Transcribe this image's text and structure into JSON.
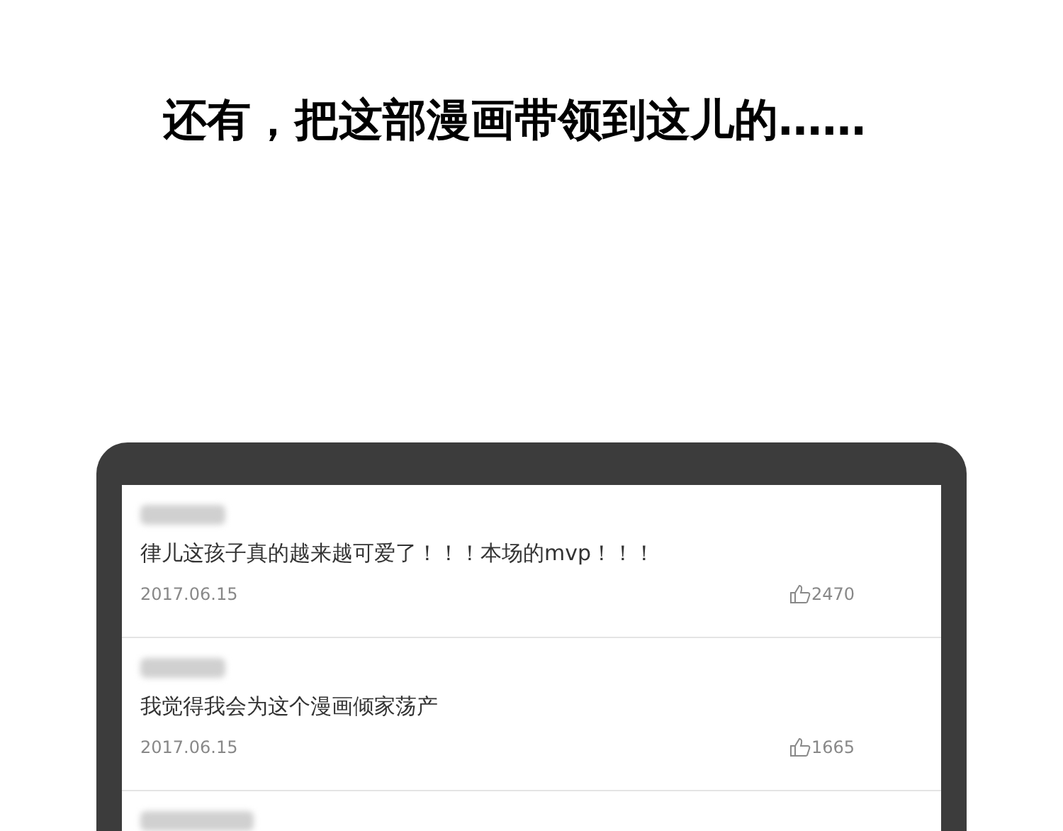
{
  "caption": "还有，把这部漫画带领到这儿的……",
  "comments": [
    {
      "text": "律儿这孩子真的越来越可爱了！！！本场的mvp！！！",
      "date": "2017.06.15",
      "likes": "2470"
    },
    {
      "text": "我觉得我会为这个漫画倾家荡产",
      "date": "2017.06.15",
      "likes": "1665"
    }
  ]
}
